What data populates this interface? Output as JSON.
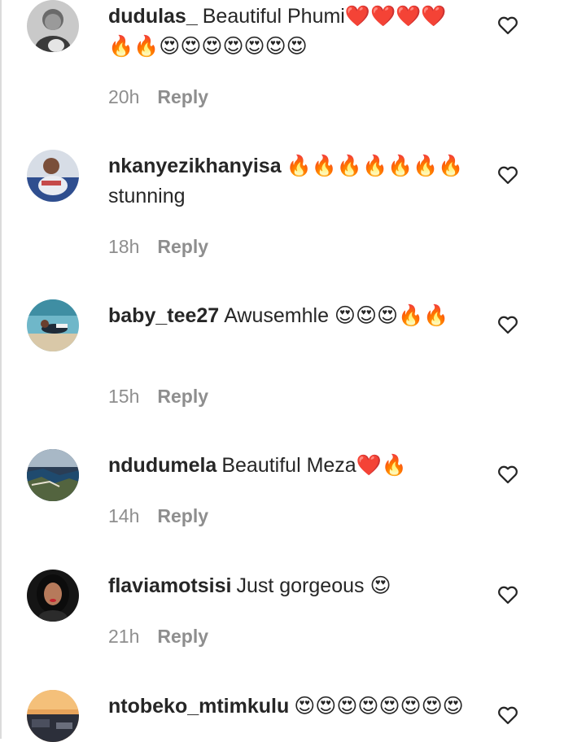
{
  "comments": [
    {
      "username": "dudulas_",
      "text": "Beautiful Phumi❤️❤️❤️❤️🔥🔥😍😍😍😍😍😍😍",
      "time": "20h",
      "reply": "Reply",
      "avatar_icon": "avatar-woman-portrait-bw",
      "like_icon": "heart-outline-icon"
    },
    {
      "username": "nkanyezikhanyisa",
      "text": "🔥🔥🔥🔥🔥🔥🔥stunning",
      "time": "18h",
      "reply": "Reply",
      "avatar_icon": "avatar-person-blue",
      "like_icon": "heart-outline-icon"
    },
    {
      "username": "baby_tee27",
      "text": "Awusemhle 😍😍😍🔥🔥",
      "time": "15h",
      "reply": "Reply",
      "avatar_icon": "avatar-beach-scene",
      "like_icon": "heart-outline-icon"
    },
    {
      "username": "ndudumela",
      "text": "Beautiful Meza❤️🔥",
      "time": "14h",
      "reply": "Reply",
      "avatar_icon": "avatar-coastline-aerial",
      "like_icon": "heart-outline-icon"
    },
    {
      "username": "flaviamotsisi",
      "text": "Just gorgeous 😍",
      "time": "21h",
      "reply": "Reply",
      "avatar_icon": "avatar-woman-dark-hair",
      "like_icon": "heart-outline-icon"
    },
    {
      "username": "ntobeko_mtimkulu",
      "text": "😍😍😍😍😍😍😍😍",
      "avatar_icon": "avatar-sunset-street",
      "like_icon": "heart-outline-icon"
    }
  ],
  "colors": {
    "text": "#262626",
    "secondary": "#8e8e8e",
    "divider": "#dbdbdb"
  }
}
